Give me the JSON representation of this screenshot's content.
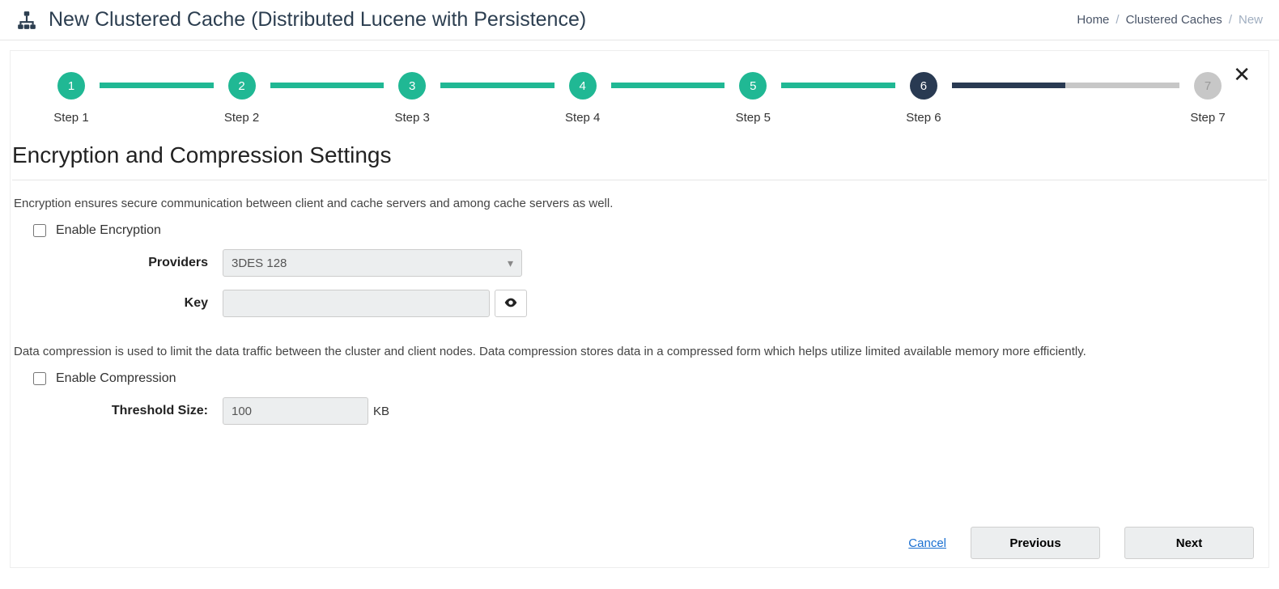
{
  "header": {
    "title": "New Clustered Cache (Distributed Lucene with Persistence)"
  },
  "breadcrumbs": {
    "items": [
      {
        "label": "Home"
      },
      {
        "label": "Clustered Caches"
      },
      {
        "label": "New"
      }
    ]
  },
  "stepper": {
    "steps": [
      {
        "num": "1",
        "label": "Step 1",
        "state": "done"
      },
      {
        "num": "2",
        "label": "Step 2",
        "state": "done"
      },
      {
        "num": "3",
        "label": "Step 3",
        "state": "done"
      },
      {
        "num": "4",
        "label": "Step 4",
        "state": "done"
      },
      {
        "num": "5",
        "label": "Step 5",
        "state": "done"
      },
      {
        "num": "6",
        "label": "Step 6",
        "state": "current"
      },
      {
        "num": "7",
        "label": "Step 7",
        "state": "future"
      }
    ]
  },
  "section": {
    "title": "Encryption and Compression Settings"
  },
  "encryption": {
    "desc": "Encryption ensures secure communication between client and cache servers and among cache servers as well.",
    "enable_label": "Enable Encryption",
    "providers_label": "Providers",
    "provider_value": "3DES 128",
    "key_label": "Key",
    "key_value": ""
  },
  "compression": {
    "desc": "Data compression is used to limit the data traffic between the cluster and client nodes. Data compression stores data in a compressed form which helps utilize limited available memory more efficiently.",
    "enable_label": "Enable Compression",
    "threshold_label": "Threshold Size:",
    "threshold_value": "100",
    "threshold_unit": "KB"
  },
  "footer": {
    "cancel": "Cancel",
    "previous": "Previous",
    "next": "Next"
  }
}
